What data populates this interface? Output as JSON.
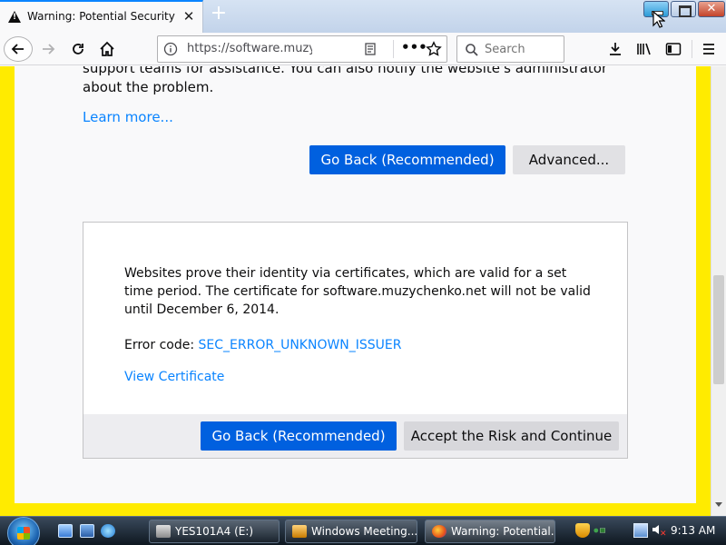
{
  "tab": {
    "title": "Warning: Potential Security Risk Ahead",
    "close": "✕",
    "new_tab": "+"
  },
  "window_controls": {
    "close": "✕"
  },
  "navbar": {
    "url": "https://software.muzychenko.net",
    "more": "•••",
    "search_placeholder": "Search"
  },
  "page": {
    "cut_text": "support teams for assistance. You can also notify the website's administrator about the problem.",
    "learn_more": "Learn more...",
    "go_back_label": "Go Back (Recommended)",
    "advanced_label": "Advanced..."
  },
  "advanced_panel": {
    "description": "Websites prove their identity via certificates, which are valid for a set time period. The certificate for software.muzychenko.net will not be valid until December 6, 2014.",
    "error_code_label": "Error code: ",
    "error_code": "SEC_ERROR_UNKNOWN_ISSUER",
    "view_certificate": "View Certificate",
    "go_back_label": "Go Back (Recommended)",
    "accept_label": "Accept the Risk and Continue"
  },
  "taskbar": {
    "items": [
      {
        "label": "YES101A4 (E:)"
      },
      {
        "label": "Windows Meeting..."
      },
      {
        "label": "Warning: Potential..."
      }
    ],
    "clock": "9:13 AM"
  },
  "colors": {
    "accent": "#0060df",
    "link": "#0a84ff",
    "frame_yellow": "#ffeb00",
    "tab_highlight": "#0a84ff"
  }
}
